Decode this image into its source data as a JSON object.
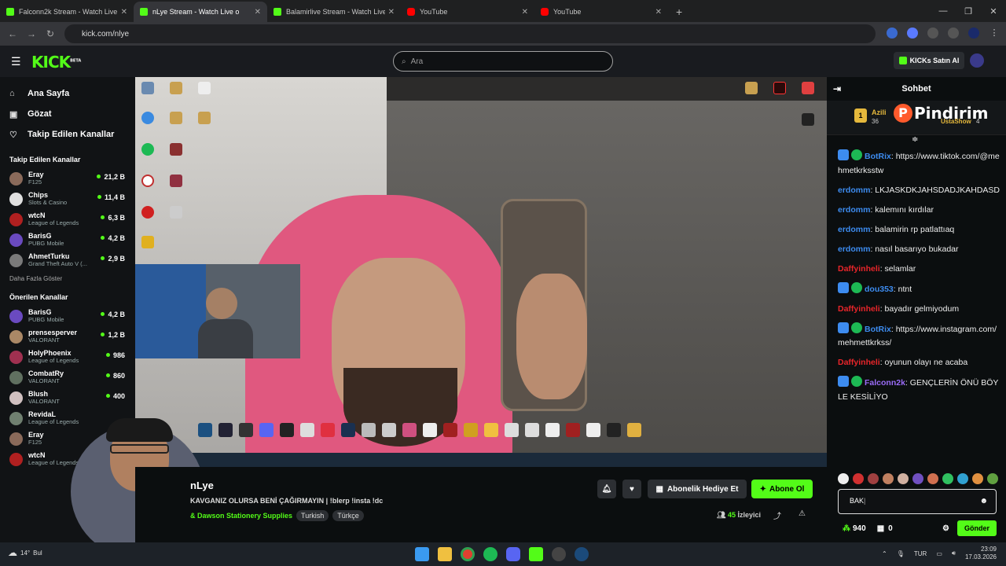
{
  "browser": {
    "tabs": [
      {
        "title": "Falconn2k Stream - Watch Live",
        "favicon": "kick-icon"
      },
      {
        "title": "nLye Stream - Watch Live o",
        "favicon": "kick-icon",
        "active": true
      },
      {
        "title": "Balamirlive Stream - Watch Live",
        "favicon": "kick-icon"
      },
      {
        "title": "YouTube",
        "favicon": "youtube-icon"
      },
      {
        "title": "YouTube",
        "favicon": "youtube-icon"
      }
    ],
    "url": "kick.com/nlye"
  },
  "header": {
    "logo": "KICK",
    "logo_badge": "BETA",
    "search_placeholder": "Ara",
    "buy_kicks": "KICKs Satın Al"
  },
  "sidebar": {
    "nav": [
      {
        "label": "Ana Sayfa",
        "icon": "home-icon"
      },
      {
        "label": "Gözat",
        "icon": "browse-icon"
      },
      {
        "label": "Takip Edilen Kanallar",
        "icon": "heart-icon"
      }
    ],
    "followed_title": "Takip Edilen Kanallar",
    "followed": [
      {
        "name": "Eray",
        "category": "F125",
        "viewers": "21,2 B",
        "color": "#8a6a5a"
      },
      {
        "name": "Chips",
        "category": "Slots & Casino",
        "viewers": "11,4 B",
        "color": "#e0e0e0"
      },
      {
        "name": "wtcN",
        "category": "League of Legends",
        "viewers": "6,3 B",
        "color": "#b02020"
      },
      {
        "name": "BarisG",
        "category": "PUBG Mobile",
        "viewers": "4,2 B",
        "color": "#6a4ac0"
      },
      {
        "name": "AhmetTurku",
        "category": "Grand Theft Auto V (...",
        "viewers": "2,9 B",
        "color": "#7a7a7a"
      }
    ],
    "show_more": "Daha Fazla Göster",
    "recommended_title": "Önerilen Kanallar",
    "recommended": [
      {
        "name": "BarisG",
        "category": "PUBG Mobile",
        "viewers": "4,2 B",
        "color": "#6a4ac0"
      },
      {
        "name": "prensesperver",
        "category": "VALORANT",
        "viewers": "1,2 B",
        "color": "#aa8866"
      },
      {
        "name": "HolyPhoenix",
        "category": "League of Legends",
        "viewers": "986",
        "color": "#a03050"
      },
      {
        "name": "CombatRy",
        "category": "VALORANT",
        "viewers": "860",
        "color": "#607060"
      },
      {
        "name": "Blush",
        "category": "VALORANT",
        "viewers": "400",
        "color": "#d0c0c0"
      },
      {
        "name": "RevidaL",
        "category": "League of Legends",
        "viewers": "",
        "color": "#708070"
      },
      {
        "name": "Eray",
        "category": "F125",
        "viewers": "",
        "color": "#8a6a5a"
      },
      {
        "name": "wtcN",
        "category": "League of Legends",
        "viewers": "",
        "color": "#b02020"
      }
    ]
  },
  "stream": {
    "channel": "nLye",
    "title": "KAVGANIZ OLURSA BENİ ÇAĞIRMAYIN | !blerp !insta !dc",
    "category": "& Dawson Stationery Supplies",
    "tags": [
      "Turkish",
      "Türkçe"
    ],
    "gift_sub": "Abonelik Hediye Et",
    "subscribe": "Abone Ol",
    "viewers": "45",
    "viewers_label": "İzleyici"
  },
  "chat": {
    "title": "Sohbet",
    "pinned": {
      "rank": "1",
      "user": "Azili",
      "count": "36",
      "other_user": "UstaShow",
      "other_count": "4"
    },
    "watermark": "Pindirim",
    "messages": [
      {
        "user": "BotRix",
        "color": "blue",
        "text": "https://www.tiktok.com/@mehmetkrksstw",
        "badges": true
      },
      {
        "user": "erdomm",
        "color": "blue",
        "text": "LKJASKDKJAHSDADJKAHDASD"
      },
      {
        "user": "erdomm",
        "color": "blue",
        "text": "kalemını kırdılar"
      },
      {
        "user": "erdomm",
        "color": "blue",
        "text": "balamirin rp patlattıaq"
      },
      {
        "user": "erdomm",
        "color": "blue",
        "text": "nasıl basarıyo bukadar"
      },
      {
        "user": "Daffyinheli",
        "color": "red",
        "text": "selamlar"
      },
      {
        "user": "dou353",
        "color": "blue",
        "text": "ntnt",
        "badges": true
      },
      {
        "user": "Daffyinheli",
        "color": "red",
        "text": "bayadır gelmiyodum"
      },
      {
        "user": "BotRix",
        "color": "blue",
        "text": "https://www.instagram.com/mehmettkrkss/",
        "badges": true
      },
      {
        "user": "Daffyinheli",
        "color": "red",
        "text": "oyunun olayı ne acaba"
      },
      {
        "user": "Falconn2k",
        "color": "purple",
        "text": "GENÇLERİN ÖNÜ BÖYLE KESİLİYO",
        "badges": true
      }
    ],
    "input_value": "BAK",
    "points": "940",
    "gifts": "0",
    "send": "Gönder"
  },
  "taskbar": {
    "temp": "14°",
    "weather_label": "Bul",
    "lang": "TUR",
    "time": "23:09",
    "date": "17.03.2026"
  },
  "colors": {
    "brand": "#53fc18",
    "background": "#0b0e0f"
  }
}
